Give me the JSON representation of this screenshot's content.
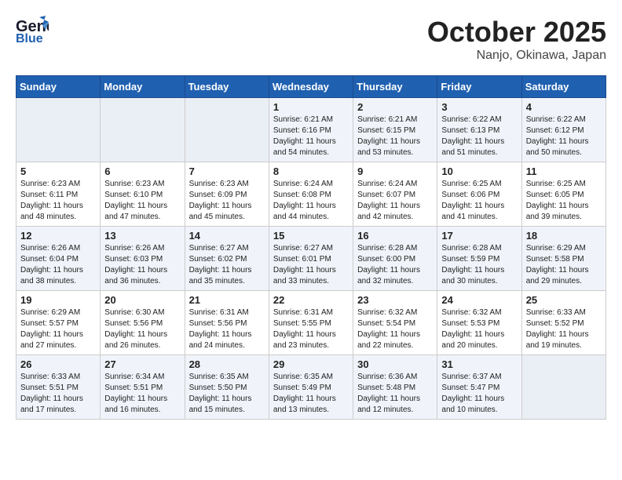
{
  "header": {
    "logo_general": "General",
    "logo_blue": "Blue",
    "month": "October 2025",
    "location": "Nanjo, Okinawa, Japan"
  },
  "days_of_week": [
    "Sunday",
    "Monday",
    "Tuesday",
    "Wednesday",
    "Thursday",
    "Friday",
    "Saturday"
  ],
  "weeks": [
    [
      {
        "day": "",
        "info": ""
      },
      {
        "day": "",
        "info": ""
      },
      {
        "day": "",
        "info": ""
      },
      {
        "day": "1",
        "info": "Sunrise: 6:21 AM\nSunset: 6:16 PM\nDaylight: 11 hours\nand 54 minutes."
      },
      {
        "day": "2",
        "info": "Sunrise: 6:21 AM\nSunset: 6:15 PM\nDaylight: 11 hours\nand 53 minutes."
      },
      {
        "day": "3",
        "info": "Sunrise: 6:22 AM\nSunset: 6:13 PM\nDaylight: 11 hours\nand 51 minutes."
      },
      {
        "day": "4",
        "info": "Sunrise: 6:22 AM\nSunset: 6:12 PM\nDaylight: 11 hours\nand 50 minutes."
      }
    ],
    [
      {
        "day": "5",
        "info": "Sunrise: 6:23 AM\nSunset: 6:11 PM\nDaylight: 11 hours\nand 48 minutes."
      },
      {
        "day": "6",
        "info": "Sunrise: 6:23 AM\nSunset: 6:10 PM\nDaylight: 11 hours\nand 47 minutes."
      },
      {
        "day": "7",
        "info": "Sunrise: 6:23 AM\nSunset: 6:09 PM\nDaylight: 11 hours\nand 45 minutes."
      },
      {
        "day": "8",
        "info": "Sunrise: 6:24 AM\nSunset: 6:08 PM\nDaylight: 11 hours\nand 44 minutes."
      },
      {
        "day": "9",
        "info": "Sunrise: 6:24 AM\nSunset: 6:07 PM\nDaylight: 11 hours\nand 42 minutes."
      },
      {
        "day": "10",
        "info": "Sunrise: 6:25 AM\nSunset: 6:06 PM\nDaylight: 11 hours\nand 41 minutes."
      },
      {
        "day": "11",
        "info": "Sunrise: 6:25 AM\nSunset: 6:05 PM\nDaylight: 11 hours\nand 39 minutes."
      }
    ],
    [
      {
        "day": "12",
        "info": "Sunrise: 6:26 AM\nSunset: 6:04 PM\nDaylight: 11 hours\nand 38 minutes."
      },
      {
        "day": "13",
        "info": "Sunrise: 6:26 AM\nSunset: 6:03 PM\nDaylight: 11 hours\nand 36 minutes."
      },
      {
        "day": "14",
        "info": "Sunrise: 6:27 AM\nSunset: 6:02 PM\nDaylight: 11 hours\nand 35 minutes."
      },
      {
        "day": "15",
        "info": "Sunrise: 6:27 AM\nSunset: 6:01 PM\nDaylight: 11 hours\nand 33 minutes."
      },
      {
        "day": "16",
        "info": "Sunrise: 6:28 AM\nSunset: 6:00 PM\nDaylight: 11 hours\nand 32 minutes."
      },
      {
        "day": "17",
        "info": "Sunrise: 6:28 AM\nSunset: 5:59 PM\nDaylight: 11 hours\nand 30 minutes."
      },
      {
        "day": "18",
        "info": "Sunrise: 6:29 AM\nSunset: 5:58 PM\nDaylight: 11 hours\nand 29 minutes."
      }
    ],
    [
      {
        "day": "19",
        "info": "Sunrise: 6:29 AM\nSunset: 5:57 PM\nDaylight: 11 hours\nand 27 minutes."
      },
      {
        "day": "20",
        "info": "Sunrise: 6:30 AM\nSunset: 5:56 PM\nDaylight: 11 hours\nand 26 minutes."
      },
      {
        "day": "21",
        "info": "Sunrise: 6:31 AM\nSunset: 5:56 PM\nDaylight: 11 hours\nand 24 minutes."
      },
      {
        "day": "22",
        "info": "Sunrise: 6:31 AM\nSunset: 5:55 PM\nDaylight: 11 hours\nand 23 minutes."
      },
      {
        "day": "23",
        "info": "Sunrise: 6:32 AM\nSunset: 5:54 PM\nDaylight: 11 hours\nand 22 minutes."
      },
      {
        "day": "24",
        "info": "Sunrise: 6:32 AM\nSunset: 5:53 PM\nDaylight: 11 hours\nand 20 minutes."
      },
      {
        "day": "25",
        "info": "Sunrise: 6:33 AM\nSunset: 5:52 PM\nDaylight: 11 hours\nand 19 minutes."
      }
    ],
    [
      {
        "day": "26",
        "info": "Sunrise: 6:33 AM\nSunset: 5:51 PM\nDaylight: 11 hours\nand 17 minutes."
      },
      {
        "day": "27",
        "info": "Sunrise: 6:34 AM\nSunset: 5:51 PM\nDaylight: 11 hours\nand 16 minutes."
      },
      {
        "day": "28",
        "info": "Sunrise: 6:35 AM\nSunset: 5:50 PM\nDaylight: 11 hours\nand 15 minutes."
      },
      {
        "day": "29",
        "info": "Sunrise: 6:35 AM\nSunset: 5:49 PM\nDaylight: 11 hours\nand 13 minutes."
      },
      {
        "day": "30",
        "info": "Sunrise: 6:36 AM\nSunset: 5:48 PM\nDaylight: 11 hours\nand 12 minutes."
      },
      {
        "day": "31",
        "info": "Sunrise: 6:37 AM\nSunset: 5:47 PM\nDaylight: 11 hours\nand 10 minutes."
      },
      {
        "day": "",
        "info": ""
      }
    ]
  ],
  "row_colors": [
    "light",
    "white",
    "light",
    "white",
    "light"
  ]
}
